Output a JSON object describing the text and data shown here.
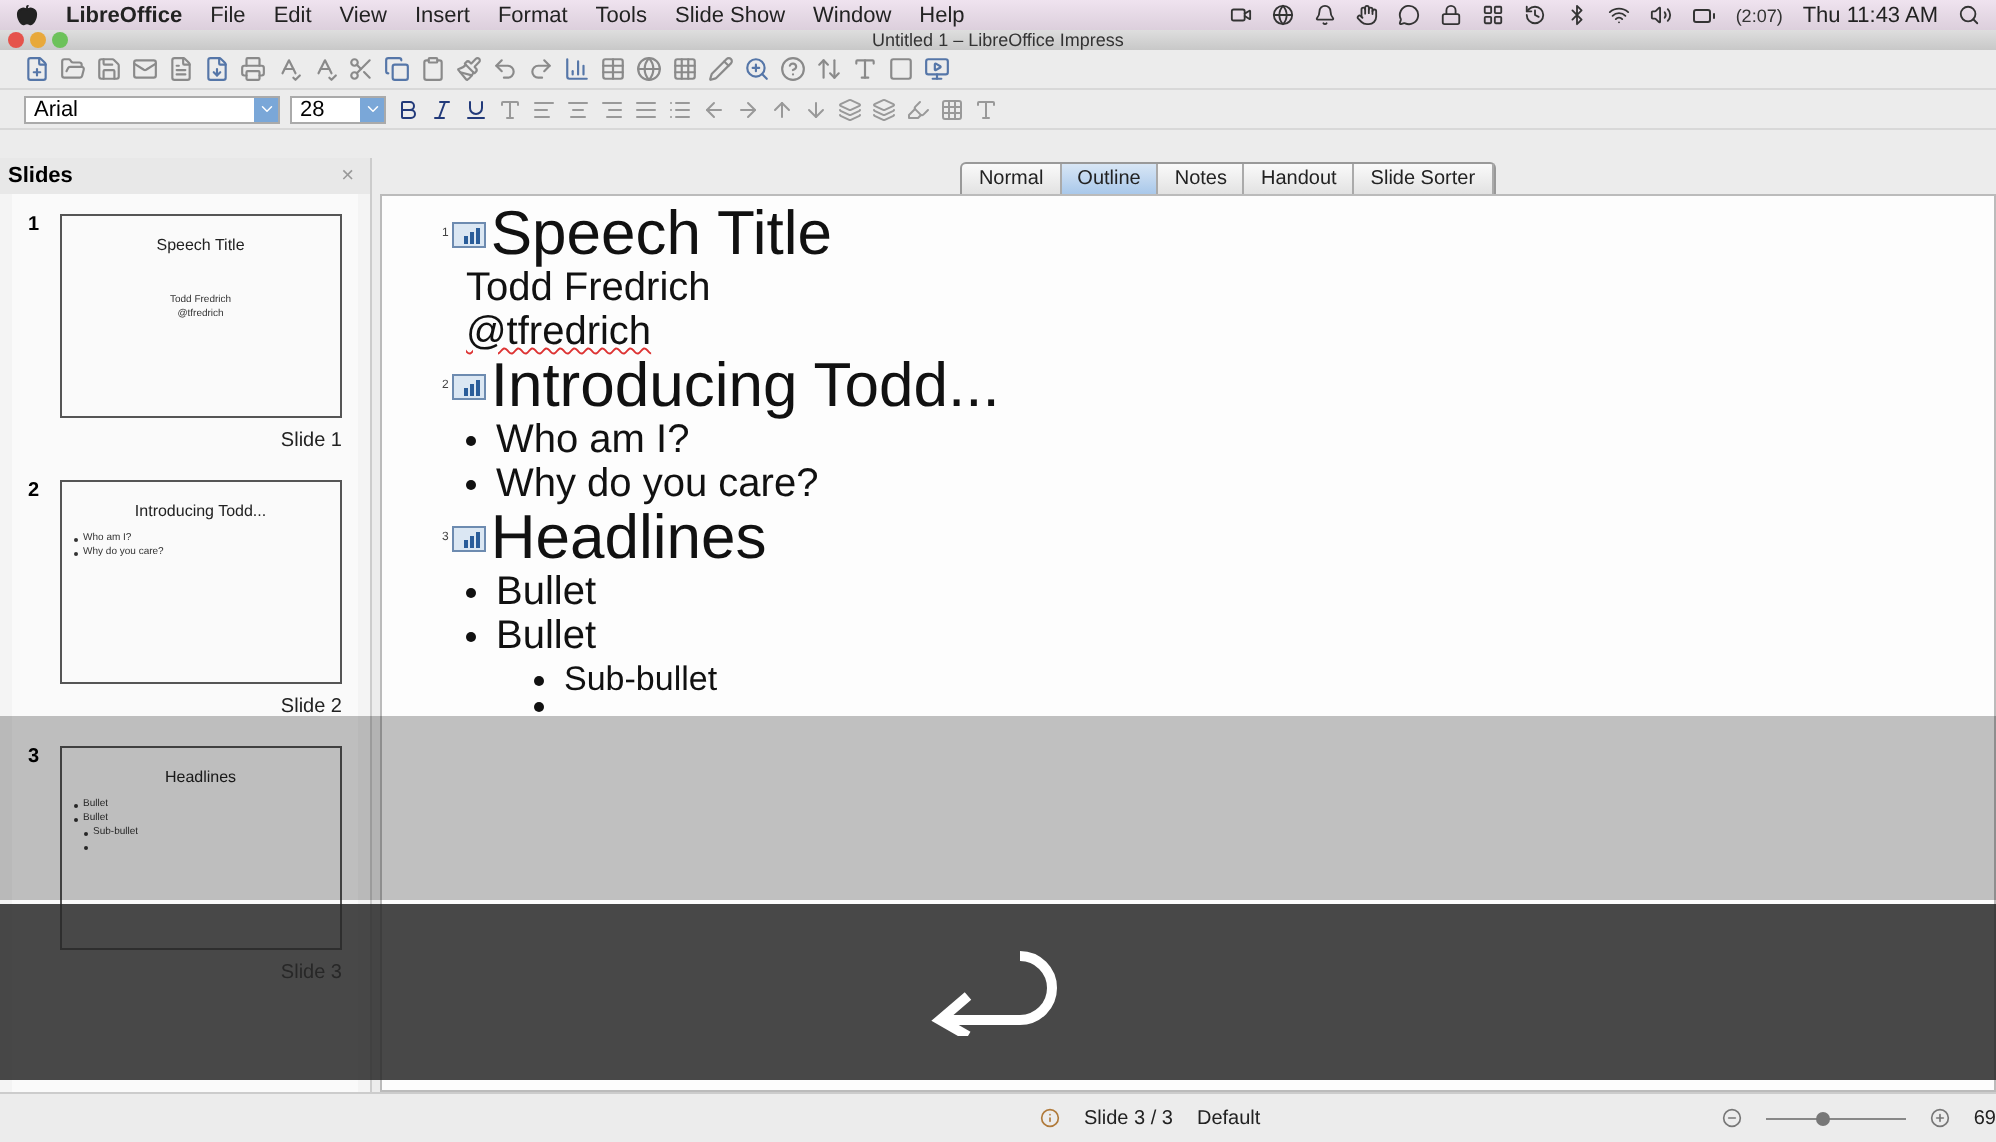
{
  "menu_bar": {
    "app": "LibreOffice",
    "items": [
      "File",
      "Edit",
      "View",
      "Insert",
      "Format",
      "Tools",
      "Slide Show",
      "Window",
      "Help"
    ],
    "battery": "(2:07)",
    "clock": "Thu 11:43 AM"
  },
  "window": {
    "title": "Untitled 1 – LibreOffice Impress"
  },
  "formatting_toolbar": {
    "font": "Arial",
    "size": "28"
  },
  "slides_panel": {
    "title": "Slides",
    "close": "×",
    "slides": [
      {
        "number": "1",
        "label": "Slide 1",
        "kind": "title",
        "title": "Speech Title",
        "lines": [
          {
            "kind": "text",
            "text": "Todd Fredrich"
          },
          {
            "kind": "text",
            "text": "@tfredrich"
          }
        ]
      },
      {
        "number": "2",
        "label": "Slide 2",
        "kind": "bullets",
        "title": "Introducing Todd...",
        "lines": [
          {
            "kind": "bullet",
            "text": "Who am I?"
          },
          {
            "kind": "bullet",
            "text": "Why do you care?"
          }
        ]
      },
      {
        "number": "3",
        "label": "Slide 3",
        "kind": "bullets",
        "title": "Headlines",
        "lines": [
          {
            "kind": "bullet",
            "text": "Bullet"
          },
          {
            "kind": "bullet",
            "text": "Bullet",
            "children": [
              {
                "kind": "bullet",
                "text": "Sub-bullet"
              },
              {
                "kind": "empty-bullet"
              }
            ]
          }
        ]
      }
    ]
  },
  "view_tabs": [
    {
      "label": "Normal",
      "selected": false
    },
    {
      "label": "Outline",
      "selected": true
    },
    {
      "label": "Notes",
      "selected": false
    },
    {
      "label": "Handout",
      "selected": false
    },
    {
      "label": "Slide Sorter",
      "selected": false
    }
  ],
  "outline": [
    {
      "number": "1",
      "title": "Speech Title",
      "lines": [
        {
          "kind": "text",
          "text": "Todd Fredrich",
          "misspelled": false
        },
        {
          "kind": "text",
          "text": "@tfredrich",
          "misspelled": true
        }
      ]
    },
    {
      "number": "2",
      "title": "Introducing Todd...",
      "lines": [
        {
          "kind": "bullet",
          "text": "Who am I?"
        },
        {
          "kind": "bullet",
          "text": "Why do you care?"
        }
      ]
    },
    {
      "number": "3",
      "title": "Headlines",
      "lines": [
        {
          "kind": "bullet",
          "text": "Bullet"
        },
        {
          "kind": "bullet",
          "text": "Bullet",
          "children": [
            {
              "kind": "bullet",
              "text": "Sub-bullet"
            },
            {
              "kind": "empty-bullet"
            }
          ]
        }
      ]
    }
  ],
  "key_overlay": {
    "kind": "return"
  },
  "status_bar": {
    "slide": "Slide 3 / 3",
    "layout": "Default",
    "zoom": "69",
    "level": 0.4
  }
}
